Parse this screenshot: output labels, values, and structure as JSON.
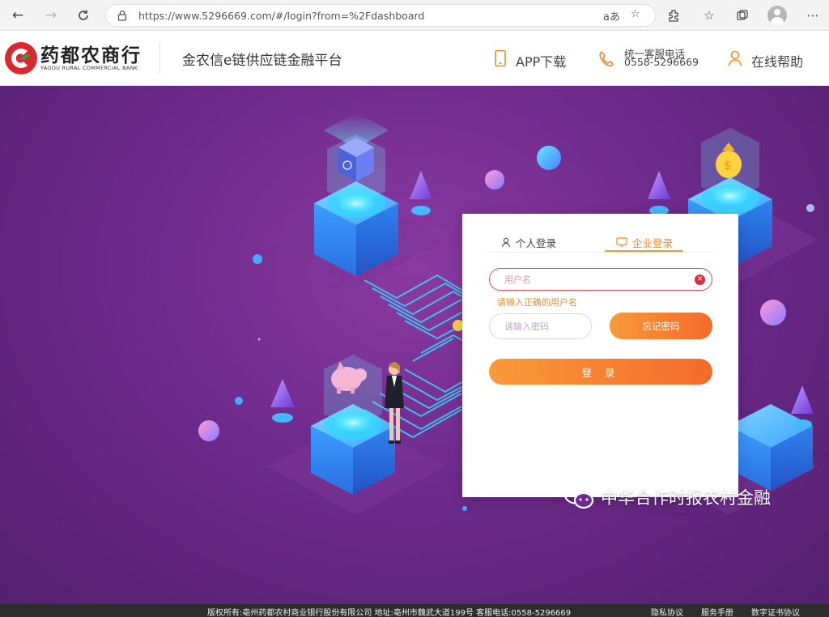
{
  "browser": {
    "url": "https://www.5296669.com/#/login?from=%2Fdashboard",
    "read_aloud_label": "aあ",
    "icons": [
      "back-icon",
      "forward-icon",
      "refresh-icon",
      "lock-icon",
      "read-aloud-icon",
      "favorite-add-icon",
      "extensions-icon",
      "favorites-icon",
      "collections-icon",
      "profile-icon",
      "more-icon"
    ]
  },
  "header": {
    "logo_cn": "药都农商行",
    "logo_en": "YAODU RURAL COMMERCIAL BANK",
    "platform_title": "金农信e链供应链金融平台",
    "app_download": "APP下载",
    "hotline_label": "统一客服电话",
    "hotline_number": "0558-5296669",
    "online_help": "在线帮助",
    "brand_red": "#d9282f",
    "accent_orange": "#f08a24"
  },
  "login": {
    "tab_personal": "个人登录",
    "tab_enterprise": "企业登录",
    "active_tab": "tab_enterprise",
    "username_placeholder": "用户名",
    "username_error": "请输入正确的用户名",
    "password_placeholder": "请输入密码",
    "forgot_button": "忘记密码",
    "login_button": "登 录"
  },
  "watermark": {
    "text": "中华合作时报农村金融"
  },
  "footer": {
    "copyright": "版权所有:亳州药都农村商业银行股份有限公司  地址:亳州市魏武大道199号  客服电话:0558-5296669",
    "privacy": "隐私协议",
    "service_manual": "服务手册",
    "certificate_protocol": "数字证书协议"
  }
}
